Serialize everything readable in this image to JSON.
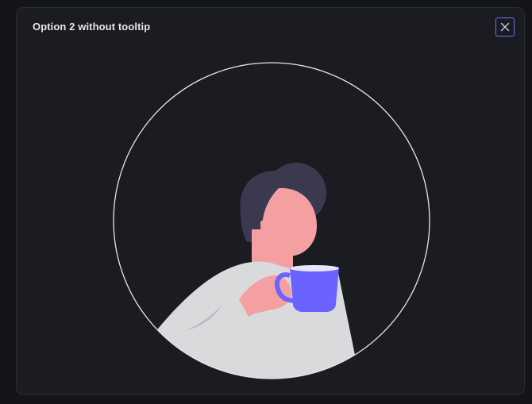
{
  "modal": {
    "title": "Option 2 without tooltip",
    "close_icon": "close-icon"
  },
  "illustration": {
    "name": "person-with-coffee-mug",
    "colors": {
      "background": "#1b1c21",
      "circle_outline": "#e6e6e6",
      "hair": "#3a3950",
      "skin": "#f4a0a2",
      "shirt": "#d9dadc",
      "mug": "#6b63ff",
      "accent": "#6b6ff5"
    }
  }
}
